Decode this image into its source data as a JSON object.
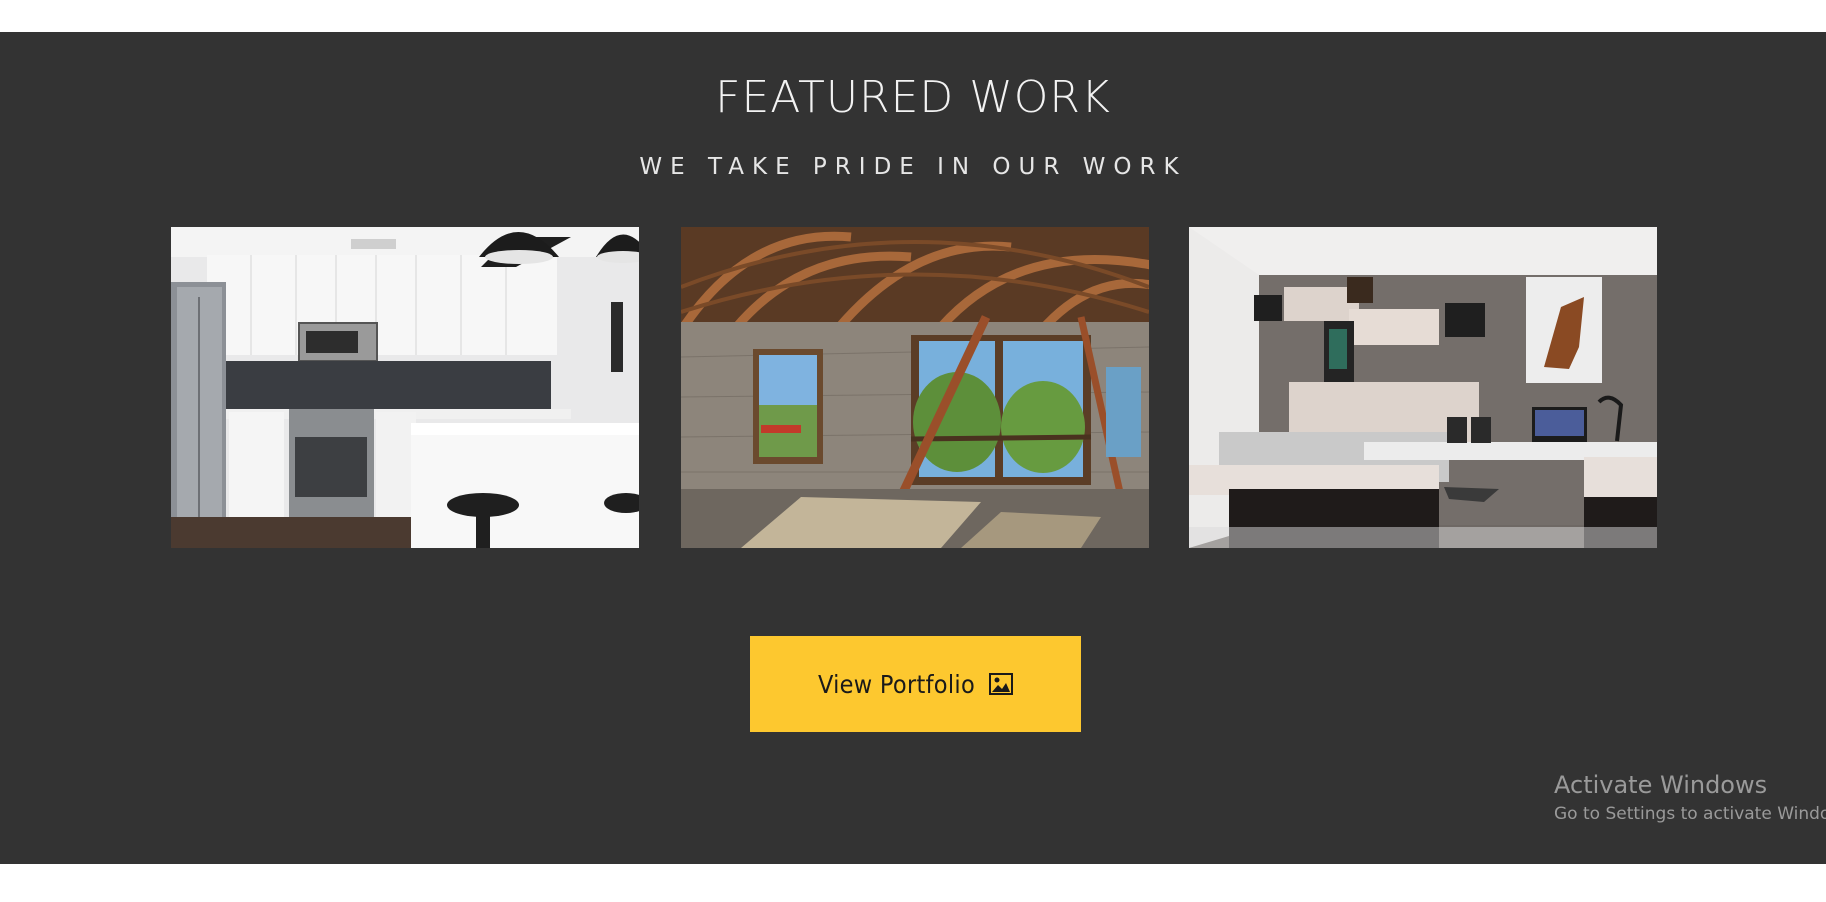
{
  "section": {
    "title": "FEATURED WORK",
    "subtitle": "WE TAKE PRIDE IN OUR WORK",
    "background": "#333333"
  },
  "gallery": [
    {
      "subject": "modern white kitchen with black pendant lamps"
    },
    {
      "subject": "panoramic attic interior with arched wooden beams and windows"
    },
    {
      "subject": "bedroom with shelves, horse picture and desk with computer"
    }
  ],
  "button": {
    "label": "View Portfolio",
    "icon": "image-icon",
    "color": "#fdc82f"
  },
  "watermark": {
    "title": "Activate Windows",
    "subtitle": "Go to Settings to activate Windows."
  }
}
